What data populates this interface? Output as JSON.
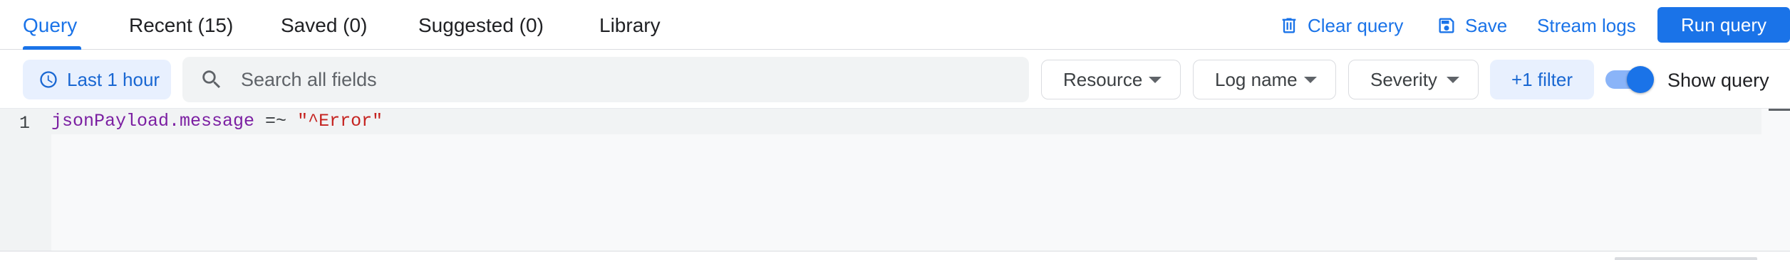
{
  "tabs": [
    {
      "label": "Query",
      "active": true
    },
    {
      "label": "Recent (15)",
      "active": false
    },
    {
      "label": "Saved (0)",
      "active": false
    },
    {
      "label": "Suggested (0)",
      "active": false
    },
    {
      "label": "Library",
      "active": false
    }
  ],
  "actions": {
    "clear_query": "Clear query",
    "save": "Save",
    "stream_logs": "Stream logs",
    "run_query": "Run query"
  },
  "filters": {
    "time_range": "Last 1 hour",
    "search_placeholder": "Search all fields",
    "resource": "Resource",
    "log_name": "Log name",
    "severity": "Severity",
    "extra_filter": "+1 filter",
    "show_query_label": "Show query",
    "show_query_on": true
  },
  "editor": {
    "line_number": "1",
    "field": "jsonPayload.message",
    "operator": " =~ ",
    "value": "\"^Error\""
  },
  "colors": {
    "accent": "#1a73e8",
    "chip_bg": "#e8f0fe",
    "field_token": "#7b1fa2",
    "string_token": "#c5221f"
  },
  "icons": [
    "trash-icon",
    "save-icon",
    "clock-icon",
    "search-icon",
    "caret-down-icon"
  ]
}
